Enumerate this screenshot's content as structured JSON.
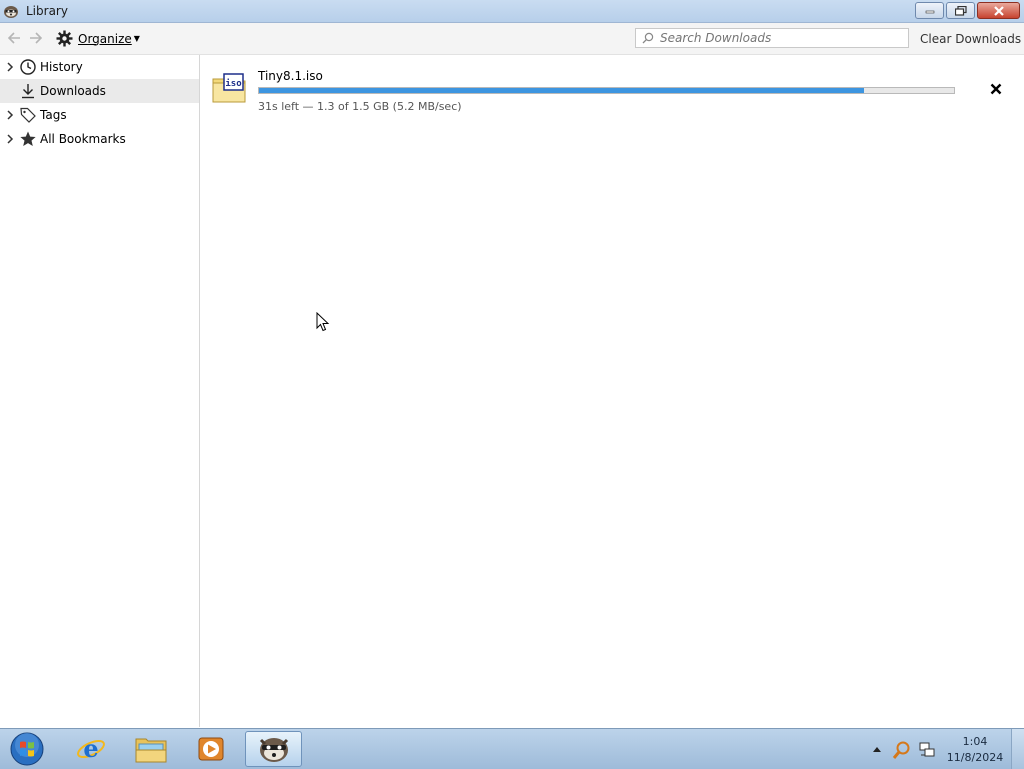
{
  "window": {
    "title": "Library",
    "app_icon": "raccoon-icon"
  },
  "toolbar": {
    "back_icon": "back-arrow-icon",
    "forward_icon": "forward-arrow-icon",
    "organize_label": "Organize",
    "search_placeholder": "Search Downloads",
    "clear_label": "Clear Downloads"
  },
  "sidebar": {
    "items": [
      {
        "label": "History",
        "icon": "clock-icon",
        "expandable": true
      },
      {
        "label": "Downloads",
        "icon": "download-icon",
        "expandable": false,
        "selected": true
      },
      {
        "label": "Tags",
        "icon": "tag-icon",
        "expandable": true
      },
      {
        "label": "All Bookmarks",
        "icon": "star-icon",
        "expandable": true
      }
    ]
  },
  "downloads": [
    {
      "name": "Tiny8.1.iso",
      "status": "31s left — 1.3 of 1.5 GB (5.2 MB/sec)",
      "progress_percent": 87,
      "file_icon_label": "iso"
    }
  ],
  "taskbar": {
    "time": "1:04",
    "date": "11/8/2024"
  },
  "colors": {
    "progress": "#3d95e0",
    "selection": "#eaeaea"
  }
}
